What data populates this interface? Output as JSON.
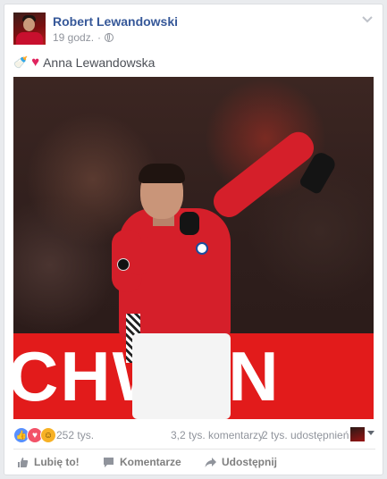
{
  "post": {
    "author": "Robert Lewandowski",
    "time": "19 godz.",
    "privacy_icon": "globe-icon",
    "tagged_name": "Anna Lewandowska",
    "photo_banner_text": "CHWAN"
  },
  "stats": {
    "reactions_count": "252 tys.",
    "comments": "3,2 tys. komentarzy",
    "shares": "2 tys. udostępnień"
  },
  "actions": {
    "like": "Lubię to!",
    "comment": "Komentarze",
    "share": "Udostępnij"
  },
  "colors": {
    "link": "#365899",
    "muted": "#90949c",
    "like_blue": "#5890ff",
    "love_red": "#f25268",
    "haha_yellow": "#f7b125",
    "banner_red": "#e21b1b"
  }
}
